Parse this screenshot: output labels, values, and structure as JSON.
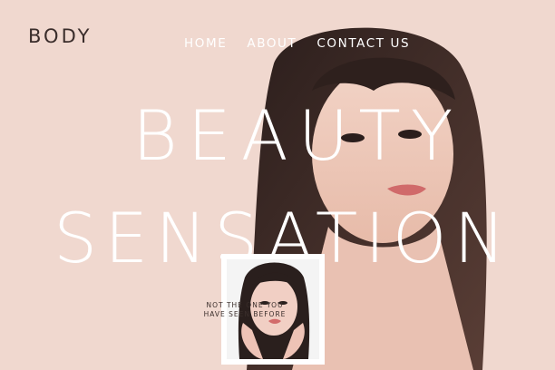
{
  "brand": {
    "logo": "BODY"
  },
  "nav": {
    "items": [
      "HOME",
      "ABOUT",
      "CONTACT US"
    ]
  },
  "hero": {
    "line1": "BEAUTY",
    "line2": "SENSATION",
    "tagline": "NOT THE ONE YOU HAVE SEEN BEFORE"
  },
  "colors": {
    "background": "#f0d8cf",
    "text_light": "#ffffff",
    "text_dark": "#3a2d2b"
  }
}
